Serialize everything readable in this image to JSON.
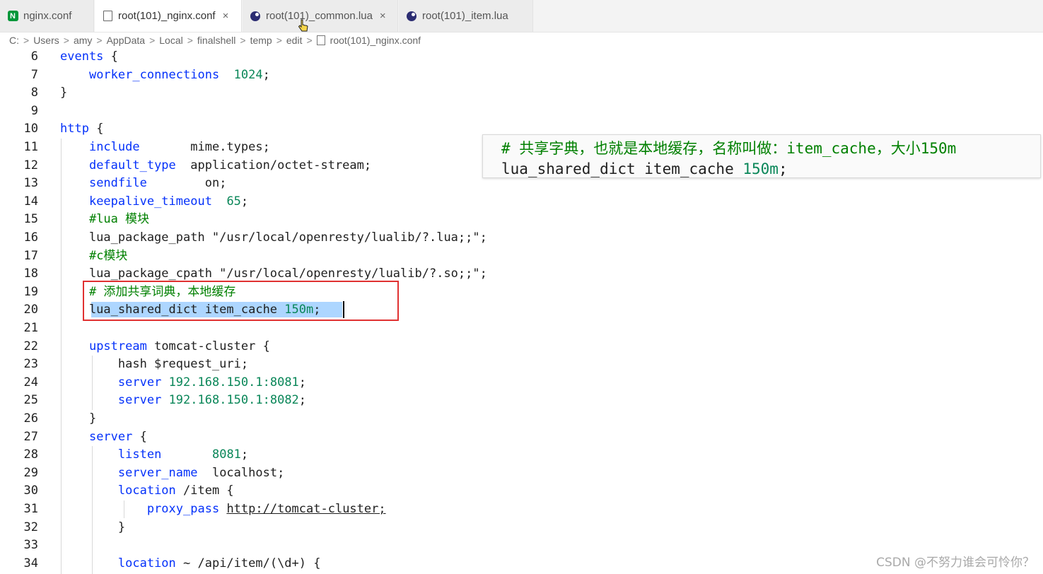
{
  "tabs": [
    {
      "label": "nginx.conf",
      "icon": "nginx-icon",
      "active": false,
      "closable": false
    },
    {
      "label": "root(101)_nginx.conf",
      "icon": "file-icon",
      "active": true,
      "closable": true
    },
    {
      "label": "root(101)_common.lua",
      "icon": "lua-icon",
      "active": false,
      "closable": true
    },
    {
      "label": "root(101)_item.lua",
      "icon": "lua-icon",
      "active": false,
      "closable": false
    }
  ],
  "close_glyph": "×",
  "breadcrumb": [
    "C:",
    "Users",
    "amy",
    "AppData",
    "Local",
    "finalshell",
    "temp",
    "edit",
    "root(101)_nginx.conf"
  ],
  "breadcrumb_sep": ">",
  "lines": [
    {
      "n": "6",
      "tokens": [
        [
          "kw",
          "events"
        ],
        [
          "t",
          " {"
        ]
      ]
    },
    {
      "n": "7",
      "tokens": [
        [
          "t",
          "    "
        ],
        [
          "kw",
          "worker_connections"
        ],
        [
          "t",
          "  "
        ],
        [
          "num",
          "1024"
        ],
        [
          "t",
          ";"
        ]
      ]
    },
    {
      "n": "8",
      "tokens": [
        [
          "t",
          "}"
        ]
      ]
    },
    {
      "n": "9",
      "tokens": []
    },
    {
      "n": "10",
      "tokens": [
        [
          "kw",
          "http"
        ],
        [
          "t",
          " {"
        ]
      ]
    },
    {
      "n": "11",
      "tokens": [
        [
          "t",
          "    "
        ],
        [
          "kw",
          "include"
        ],
        [
          "t",
          "       mime.types;"
        ]
      ]
    },
    {
      "n": "12",
      "tokens": [
        [
          "t",
          "    "
        ],
        [
          "kw",
          "default_type"
        ],
        [
          "t",
          "  application/octet-stream;"
        ]
      ]
    },
    {
      "n": "13",
      "tokens": [
        [
          "t",
          "    "
        ],
        [
          "kw",
          "sendfile"
        ],
        [
          "t",
          "        on;"
        ]
      ]
    },
    {
      "n": "14",
      "tokens": [
        [
          "t",
          "    "
        ],
        [
          "kw",
          "keepalive_timeout"
        ],
        [
          "t",
          "  "
        ],
        [
          "num",
          "65"
        ],
        [
          "t",
          ";"
        ]
      ]
    },
    {
      "n": "15",
      "tokens": [
        [
          "t",
          "    "
        ],
        [
          "cm",
          "#lua 模块"
        ]
      ]
    },
    {
      "n": "16",
      "tokens": [
        [
          "t",
          "    lua_package_path \"/usr/local/openresty/lualib/?.lua;;\";"
        ]
      ]
    },
    {
      "n": "17",
      "tokens": [
        [
          "t",
          "    "
        ],
        [
          "cm",
          "#c模块"
        ]
      ]
    },
    {
      "n": "18",
      "tokens": [
        [
          "t",
          "    lua_package_cpath \"/usr/local/openresty/lualib/?.so;;\";"
        ]
      ]
    },
    {
      "n": "19",
      "tokens": [
        [
          "t",
          "    "
        ],
        [
          "cm",
          "# 添加共享词典，本地缓存"
        ]
      ]
    },
    {
      "n": "20",
      "tokens": [
        [
          "t",
          "    lua_shared_dict item_cache "
        ],
        [
          "num",
          "150m"
        ],
        [
          "t",
          ";"
        ]
      ]
    },
    {
      "n": "21",
      "tokens": []
    },
    {
      "n": "22",
      "tokens": [
        [
          "t",
          "    "
        ],
        [
          "kw",
          "upstream"
        ],
        [
          "t",
          " tomcat-cluster {"
        ]
      ]
    },
    {
      "n": "23",
      "tokens": [
        [
          "t",
          "        hash $request_uri;"
        ]
      ]
    },
    {
      "n": "24",
      "tokens": [
        [
          "t",
          "        "
        ],
        [
          "kw",
          "server"
        ],
        [
          "t",
          " "
        ],
        [
          "num",
          "192.168.150.1:8081"
        ],
        [
          "t",
          ";"
        ]
      ]
    },
    {
      "n": "25",
      "tokens": [
        [
          "t",
          "        "
        ],
        [
          "kw",
          "server"
        ],
        [
          "t",
          " "
        ],
        [
          "num",
          "192.168.150.1:8082"
        ],
        [
          "t",
          ";"
        ]
      ]
    },
    {
      "n": "26",
      "tokens": [
        [
          "t",
          "    }"
        ]
      ]
    },
    {
      "n": "27",
      "tokens": [
        [
          "t",
          "    "
        ],
        [
          "kw",
          "server"
        ],
        [
          "t",
          " {"
        ]
      ]
    },
    {
      "n": "28",
      "tokens": [
        [
          "t",
          "        "
        ],
        [
          "kw",
          "listen"
        ],
        [
          "t",
          "       "
        ],
        [
          "num",
          "8081"
        ],
        [
          "t",
          ";"
        ]
      ]
    },
    {
      "n": "29",
      "tokens": [
        [
          "t",
          "        "
        ],
        [
          "kw",
          "server_name"
        ],
        [
          "t",
          "  localhost;"
        ]
      ]
    },
    {
      "n": "30",
      "tokens": [
        [
          "t",
          "        "
        ],
        [
          "kw",
          "location"
        ],
        [
          "t",
          " /item {"
        ]
      ]
    },
    {
      "n": "31",
      "tokens": [
        [
          "t",
          "            "
        ],
        [
          "kw",
          "proxy_pass"
        ],
        [
          "t",
          " "
        ],
        [
          "url",
          "http://tomcat-cluster;"
        ]
      ]
    },
    {
      "n": "32",
      "tokens": [
        [
          "t",
          "        }"
        ]
      ]
    },
    {
      "n": "33",
      "tokens": []
    },
    {
      "n": "34",
      "tokens": [
        [
          "t",
          "        "
        ],
        [
          "kw",
          "location"
        ],
        [
          "t",
          " ~ /api/item/(\\d+) {"
        ]
      ]
    }
  ],
  "callout": {
    "comment": "# 共享字典，也就是本地缓存，名称叫做：item_cache，大小150m",
    "code_prefix": "lua_shared_dict item_cache ",
    "code_num": "150m",
    "code_suffix": ";"
  },
  "watermark": "CSDN @不努力谁会可怜你？",
  "colors": {
    "keyword": "#0431fa",
    "comment": "#008000",
    "number": "#098658",
    "selection": "#add6ff",
    "highlight_box": "#e03131",
    "nginx_brand": "#009639",
    "lua_brand": "#2c2d72"
  }
}
